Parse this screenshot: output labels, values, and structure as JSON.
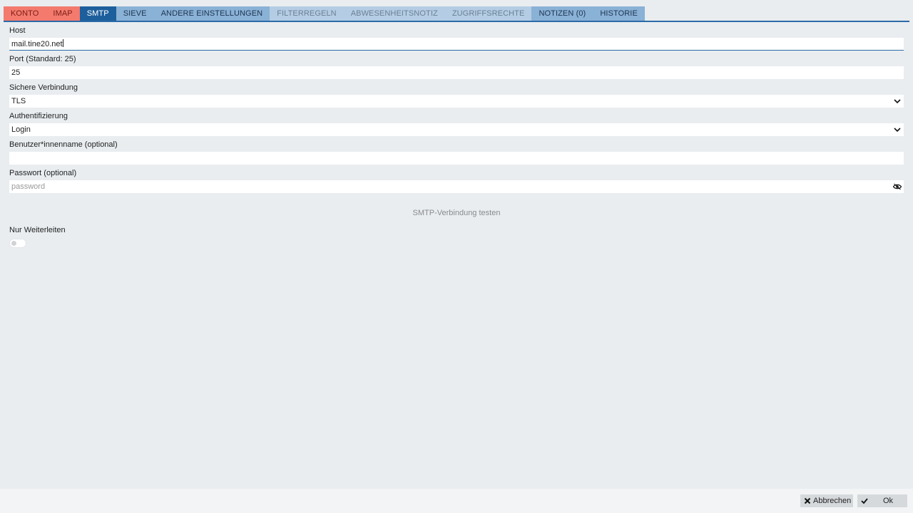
{
  "tabs": [
    {
      "label": "KONTO"
    },
    {
      "label": "IMAP"
    },
    {
      "label": "SMTP"
    },
    {
      "label": "SIEVE"
    },
    {
      "label": "ANDERE EINSTELLUNGEN"
    },
    {
      "label": "FILTERREGELN"
    },
    {
      "label": "ABWESENHEITSNOTIZ"
    },
    {
      "label": "ZUGRIFFSRECHTE"
    },
    {
      "label": "NOTIZEN (0)"
    },
    {
      "label": "HISTORIE"
    }
  ],
  "active_tab": "SMTP",
  "form": {
    "host": {
      "label": "Host",
      "value": "mail.tine20.net"
    },
    "port": {
      "label": "Port (Standard: 25)",
      "value": "25"
    },
    "secure": {
      "label": "Sichere Verbindung",
      "value": "TLS"
    },
    "auth": {
      "label": "Authentifizierung",
      "value": "Login"
    },
    "username": {
      "label": "Benutzer*innenname (optional)",
      "value": ""
    },
    "password": {
      "label": "Passwort (optional)",
      "placeholder": "password"
    }
  },
  "test_connection_label": "SMTP-Verbindung testen",
  "forward_only": {
    "label": "Nur Weiterleiten",
    "enabled": false
  },
  "footer": {
    "cancel_label": "Abbrechen",
    "ok_label": "Ok"
  },
  "colors": {
    "accent": "#1d5f9c",
    "tab_error": "#f47a6e",
    "background": "#e9edf0"
  }
}
